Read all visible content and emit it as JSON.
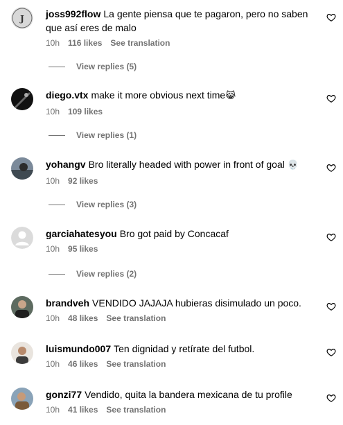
{
  "comments": [
    {
      "username": "joss992flow",
      "text": "La gente piensa que te pagaron, pero no saben que así eres de malo",
      "time": "10h",
      "likes": "116 likes",
      "translate": "See translation",
      "replies": "View replies (5)"
    },
    {
      "username": "diego.vtx",
      "text": "make it more obvious next time",
      "emoji": "😹",
      "time": "10h",
      "likes": "109 likes",
      "replies": "View replies (1)"
    },
    {
      "username": "yohangv",
      "text": "Bro literally headed with power in front of goal",
      "emoji": "💀",
      "time": "10h",
      "likes": "92 likes",
      "replies": "View replies (3)"
    },
    {
      "username": "garciahatesyou",
      "text": "Bro got paid by Concacaf",
      "time": "10h",
      "likes": "95 likes",
      "replies": "View replies (2)"
    },
    {
      "username": "brandveh",
      "text": "VENDIDO JAJAJA hubieras disimulado un poco.",
      "time": "10h",
      "likes": "48 likes",
      "translate": "See translation"
    },
    {
      "username": "luismundo007",
      "text": "Ten dignidad y retírate del futbol.",
      "time": "10h",
      "likes": "46 likes",
      "translate": "See translation"
    },
    {
      "username": "gonzi77",
      "text": "Vendido, quita la bandera mexicana de tu profile",
      "time": "10h",
      "likes": "41 likes",
      "translate": "See translation"
    }
  ],
  "colors": {
    "text": "#000000",
    "secondary": "#737373",
    "background": "#ffffff"
  },
  "icons": {
    "like": "heart-outline-icon",
    "default_avatar": "default-avatar-icon"
  }
}
